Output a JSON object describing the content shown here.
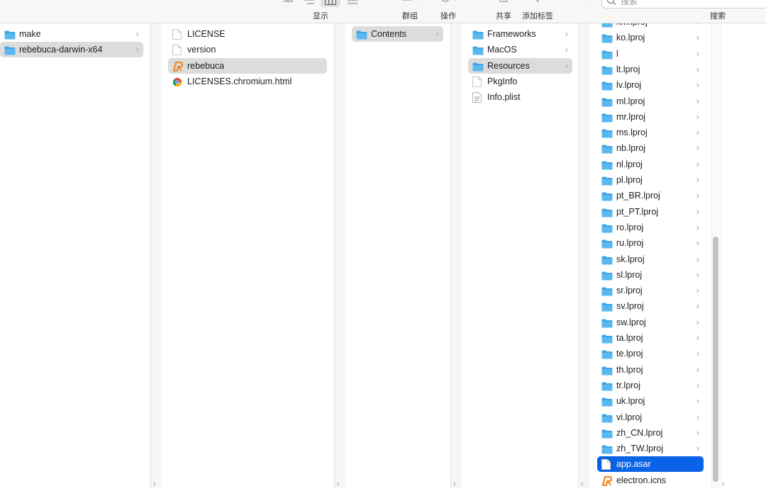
{
  "toolbar": {
    "view_label": "显示",
    "group_label": "群组",
    "action_label": "操作",
    "share_label": "共享",
    "tag_label": "添加标签",
    "search_label": "搜索",
    "search_placeholder": "搜索"
  },
  "columns": {
    "sidebar": [
      {
        "label": "make",
        "icon": "folder-icon",
        "chevron": "›"
      },
      {
        "label": "rebebuca-darwin-x64",
        "icon": "folder-icon",
        "chevron": "›"
      }
    ],
    "bundle": [
      {
        "label": "LICENSE",
        "icon": "document-icon"
      },
      {
        "label": "version",
        "icon": "document-icon"
      },
      {
        "label": "rebebuca",
        "icon": "app-icon"
      },
      {
        "label": "LICENSES.chromium.html",
        "icon": "chrome-icon"
      }
    ],
    "app": [
      {
        "label": "Contents",
        "icon": "folder-icon",
        "chevron": "›"
      }
    ],
    "contents": [
      {
        "label": "Frameworks",
        "icon": "folder-icon",
        "chevron": "›"
      },
      {
        "label": "MacOS",
        "icon": "folder-icon",
        "chevron": "›"
      },
      {
        "label": "Resources",
        "icon": "folder-icon",
        "chevron": "›"
      },
      {
        "label": "PkgInfo",
        "icon": "document-icon"
      },
      {
        "label": "Info.plist",
        "icon": "plist-icon"
      }
    ],
    "resources": [
      {
        "label": "km.lproj",
        "icon": "folder-icon",
        "chevron": "›"
      },
      {
        "label": "ko.lproj",
        "icon": "folder-icon",
        "chevron": "›"
      },
      {
        "label": "l",
        "icon": "folder-icon",
        "chevron": "›"
      },
      {
        "label": "lt.lproj",
        "icon": "folder-icon",
        "chevron": "›"
      },
      {
        "label": "lv.lproj",
        "icon": "folder-icon",
        "chevron": "›"
      },
      {
        "label": "ml.lproj",
        "icon": "folder-icon",
        "chevron": "›"
      },
      {
        "label": "mr.lproj",
        "icon": "folder-icon",
        "chevron": "›"
      },
      {
        "label": "ms.lproj",
        "icon": "folder-icon",
        "chevron": "›"
      },
      {
        "label": "nb.lproj",
        "icon": "folder-icon",
        "chevron": "›"
      },
      {
        "label": "nl.lproj",
        "icon": "folder-icon",
        "chevron": "›"
      },
      {
        "label": "pl.lproj",
        "icon": "folder-icon",
        "chevron": "›"
      },
      {
        "label": "pt_BR.lproj",
        "icon": "folder-icon",
        "chevron": "›"
      },
      {
        "label": "pt_PT.lproj",
        "icon": "folder-icon",
        "chevron": "›"
      },
      {
        "label": "ro.lproj",
        "icon": "folder-icon",
        "chevron": "›"
      },
      {
        "label": "ru.lproj",
        "icon": "folder-icon",
        "chevron": "›"
      },
      {
        "label": "sk.lproj",
        "icon": "folder-icon",
        "chevron": "›"
      },
      {
        "label": "sl.lproj",
        "icon": "folder-icon",
        "chevron": "›"
      },
      {
        "label": "sr.lproj",
        "icon": "folder-icon",
        "chevron": "›"
      },
      {
        "label": "sv.lproj",
        "icon": "folder-icon",
        "chevron": "›"
      },
      {
        "label": "sw.lproj",
        "icon": "folder-icon",
        "chevron": "›"
      },
      {
        "label": "ta.lproj",
        "icon": "folder-icon",
        "chevron": "›"
      },
      {
        "label": "te.lproj",
        "icon": "folder-icon",
        "chevron": "›"
      },
      {
        "label": "th.lproj",
        "icon": "folder-icon",
        "chevron": "›"
      },
      {
        "label": "tr.lproj",
        "icon": "folder-icon",
        "chevron": "›"
      },
      {
        "label": "uk.lproj",
        "icon": "folder-icon",
        "chevron": "›"
      },
      {
        "label": "vi.lproj",
        "icon": "folder-icon",
        "chevron": "›"
      },
      {
        "label": "zh_CN.lproj",
        "icon": "folder-icon",
        "chevron": "›"
      },
      {
        "label": "zh_TW.lproj",
        "icon": "folder-icon",
        "chevron": "›"
      },
      {
        "label": "app.asar",
        "icon": "document-icon"
      },
      {
        "label": "electron.icns",
        "icon": "app-icon"
      }
    ]
  },
  "colors": {
    "selection_active": "#0a63e6",
    "selection_inactive": "#dcdcdc",
    "folder": "#3fa6e6"
  }
}
